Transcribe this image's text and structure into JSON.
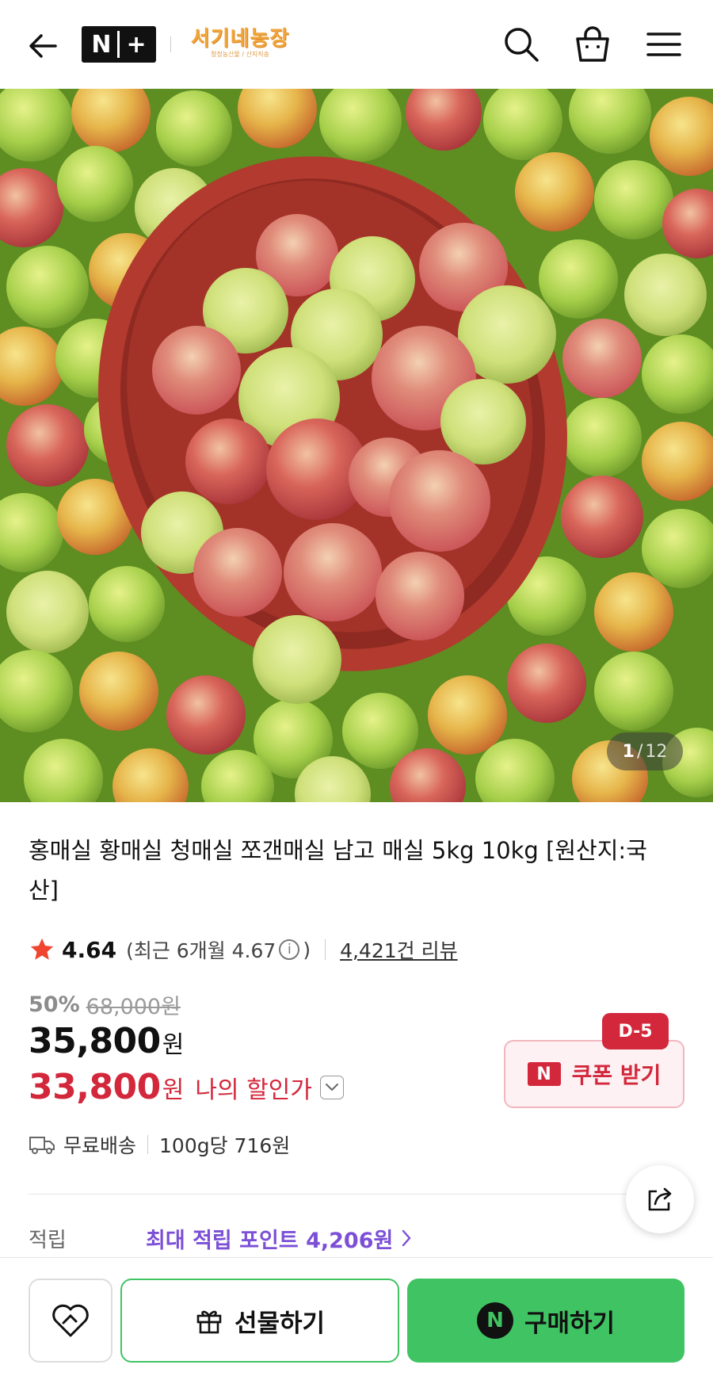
{
  "header": {
    "store_logo_text": "서기네농장",
    "store_logo_subtext": "청정농산물 / 산지직송",
    "brand_badge": "N+"
  },
  "gallery": {
    "current": "1",
    "separator": "/",
    "total": "12"
  },
  "product": {
    "title": "홍매실 황매실 청매실 쪼갠매실 남고 매실 5kg 10kg [원산지:국산]",
    "rating": "4.64",
    "recent_rating_label": "(최근 6개월 4.67",
    "recent_rating_close": ")",
    "review_count": "4,421건 리뷰",
    "discount_rate": "50%",
    "original_price": "68,000원",
    "sale_price": "35,800",
    "sale_price_unit": "원",
    "my_price": "33,800",
    "my_price_unit": "원",
    "my_price_label": "나의 할인가",
    "coupon_label": "쿠폰 받기",
    "coupon_dday": "D-5",
    "coupon_badge": "N",
    "shipping": "무료배송",
    "unit_price": "100g당 716원",
    "points_label": "적립",
    "points_value": "최대 적립 포인트 4,206원"
  },
  "bottom_bar": {
    "gift_label": "선물하기",
    "buy_label": "구매하기",
    "buy_badge": "N"
  },
  "colors": {
    "accent_red": "#d3283c",
    "buy_green": "#40c463",
    "points_purple": "#7b4fd6",
    "star_red": "#f0452f"
  },
  "icons": [
    "back-arrow-icon",
    "search-icon",
    "shopping-bag-icon",
    "hamburger-menu-icon",
    "star-icon",
    "info-icon",
    "chevron-down-icon",
    "truck-icon",
    "share-icon",
    "chevron-right-icon",
    "heart-icon",
    "gift-icon"
  ]
}
